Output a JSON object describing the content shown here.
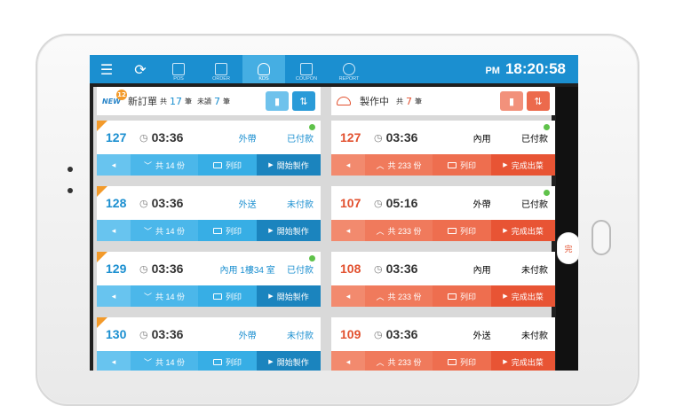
{
  "topbar": {
    "menu_icon": "menu-icon",
    "refresh_icon": "refresh-icon",
    "nav": [
      {
        "label": "POS"
      },
      {
        "label": "ORDER"
      },
      {
        "label": "KDS"
      },
      {
        "label": "COUPON"
      },
      {
        "label": "REPORT"
      }
    ],
    "ampm": "PM",
    "time": "18:20:58"
  },
  "left_panel": {
    "new_label": "NEW",
    "new_badge": "12",
    "title": "新訂單",
    "total_prefix": "共",
    "total_count": "17",
    "total_unit": "筆",
    "unread_label": "未讀",
    "unread_count": "7",
    "unread_unit": "筆",
    "orders": [
      {
        "num": "127",
        "time": "03:36",
        "type": "外帶",
        "status": "已付款",
        "count": "共 14 份",
        "print": "列印",
        "action": "開始製作"
      },
      {
        "num": "128",
        "time": "03:36",
        "type": "外送",
        "status": "未付款",
        "count": "共 14 份",
        "print": "列印",
        "action": "開始製作"
      },
      {
        "num": "129",
        "time": "03:36",
        "type": "內用 1樓34 室",
        "status": "已付款",
        "count": "共 14 份",
        "print": "列印",
        "action": "開始製作"
      },
      {
        "num": "130",
        "time": "03:36",
        "type": "外帶",
        "status": "未付款",
        "count": "共 14 份",
        "print": "列印",
        "action": "開始製作"
      }
    ]
  },
  "right_panel": {
    "title": "製作中",
    "total_prefix": "共",
    "total_count": "7",
    "total_unit": "筆",
    "orders": [
      {
        "num": "127",
        "time": "03:36",
        "type": "內用",
        "status": "已付款",
        "count": "共 233 份",
        "print": "列印",
        "action": "完成出菜"
      },
      {
        "num": "107",
        "time": "05:16",
        "type": "外帶",
        "status": "已付款",
        "count": "共 233 份",
        "print": "列印",
        "action": "完成出菜"
      },
      {
        "num": "108",
        "time": "03:36",
        "type": "內用",
        "status": "未付款",
        "count": "共 233 份",
        "print": "列印",
        "action": "完成出菜"
      },
      {
        "num": "109",
        "time": "03:36",
        "type": "外送",
        "status": "未付款",
        "count": "共 233 份",
        "print": "列印",
        "action": "完成出菜"
      }
    ]
  },
  "side_tab_label": "完",
  "colors": {
    "blue": "#1b8fd0",
    "red": "#e2512f",
    "orange": "#f39a2a",
    "green": "#5fc24a"
  }
}
